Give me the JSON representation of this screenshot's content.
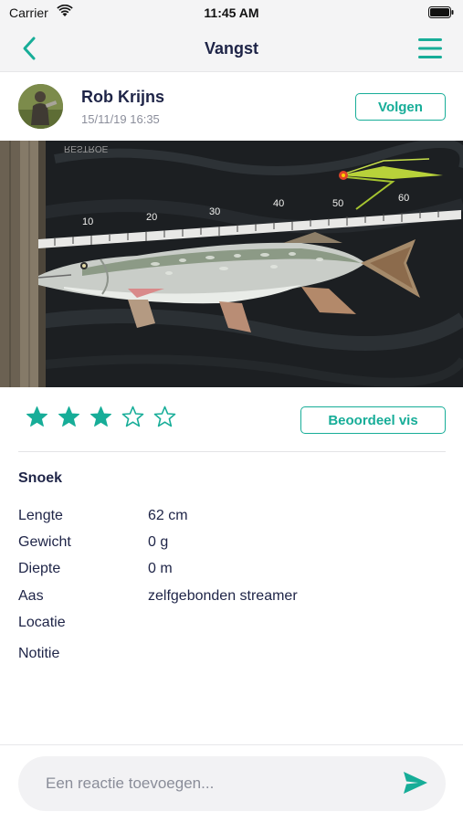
{
  "status_bar": {
    "carrier": "Carrier",
    "time": "11:45 AM"
  },
  "nav": {
    "title": "Vangst"
  },
  "post": {
    "user_name": "Rob Krijns",
    "date": "15/11/19 16:35",
    "follow_label": "Volgen"
  },
  "photo": {
    "ruler_marks": [
      "10",
      "20",
      "30",
      "40",
      "50",
      "60"
    ]
  },
  "rating": {
    "stars": 3,
    "max": 5,
    "button_label": "Beoordeel vis"
  },
  "details": {
    "species": "Snoek",
    "rows": [
      {
        "label": "Lengte",
        "value": "62 cm"
      },
      {
        "label": "Gewicht",
        "value": "0 g"
      },
      {
        "label": "Diepte",
        "value": "0 m"
      },
      {
        "label": "Aas",
        "value": "zelfgebonden streamer"
      },
      {
        "label": "Locatie",
        "value": ""
      },
      {
        "label": "Notitie",
        "value": ""
      }
    ]
  },
  "comment": {
    "placeholder": "Een reactie toevoegen..."
  },
  "colors": {
    "accent": "#17ad98",
    "text": "#1e2447",
    "muted": "#8b8e9b"
  },
  "icons": {
    "back": "chevron-left-icon",
    "menu": "hamburger-menu-icon",
    "send": "send-icon"
  }
}
